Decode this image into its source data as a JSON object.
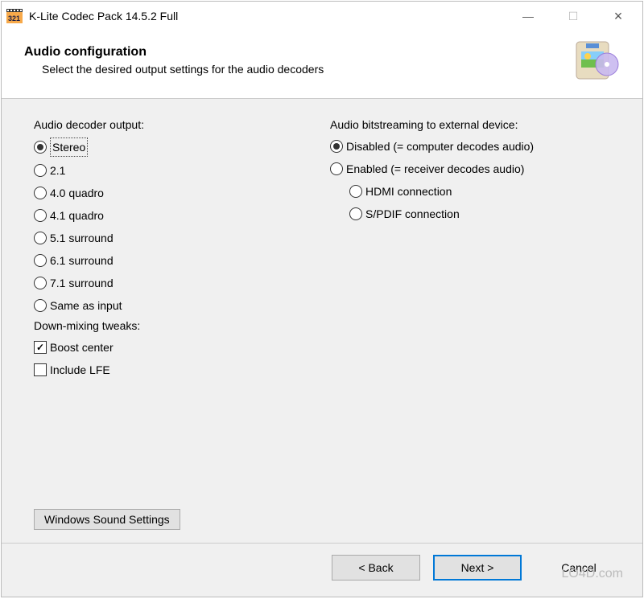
{
  "titlebar": {
    "title": "K-Lite Codec Pack 14.5.2 Full"
  },
  "header": {
    "title": "Audio configuration",
    "subtitle": "Select the desired output settings for the audio decoders"
  },
  "decoder": {
    "label": "Audio decoder output:",
    "options": [
      {
        "label": "Stereo",
        "selected": true
      },
      {
        "label": "2.1",
        "selected": false
      },
      {
        "label": "4.0 quadro",
        "selected": false
      },
      {
        "label": "4.1 quadro",
        "selected": false
      },
      {
        "label": "5.1 surround",
        "selected": false
      },
      {
        "label": "6.1 surround",
        "selected": false
      },
      {
        "label": "7.1 surround",
        "selected": false
      },
      {
        "label": "Same as input",
        "selected": false
      }
    ]
  },
  "downmix": {
    "label": "Down-mixing tweaks:",
    "boost_center": {
      "label": "Boost center",
      "checked": true
    },
    "include_lfe": {
      "label": "Include LFE",
      "checked": false
    }
  },
  "bitstream": {
    "label": "Audio bitstreaming to external device:",
    "disabled": {
      "label": "Disabled (= computer decodes audio)",
      "selected": true
    },
    "enabled": {
      "label": "Enabled  (= receiver decodes audio)",
      "selected": false
    },
    "hdmi": {
      "label": "HDMI connection",
      "selected": false
    },
    "spdif": {
      "label": "S/PDIF connection",
      "selected": false
    }
  },
  "buttons": {
    "sound_settings": "Windows Sound Settings",
    "back": "< Back",
    "next": "Next >",
    "cancel": "Cancel"
  },
  "watermark": "LO4D.com"
}
